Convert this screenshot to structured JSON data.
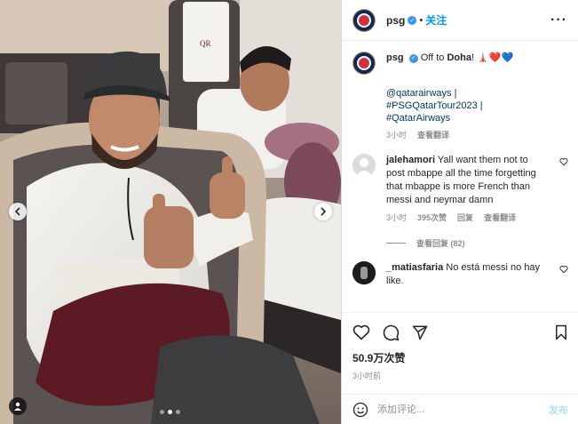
{
  "post": {
    "account": "psg",
    "follow_label": "关注",
    "dot_separator": "•",
    "more_icon": "more-horizontal-icon",
    "caption": {
      "text": "Off to ",
      "emphasis": "Doha",
      "suffix": "! ",
      "emojis": [
        "🗼",
        "❤️",
        "💙"
      ],
      "hashtags": [
        "@qatarairways |",
        "#PSGQatarTour2023 |",
        "#QatarAirways"
      ],
      "time": "3小时",
      "translate": "查看翻译"
    },
    "comments": [
      {
        "user": "jalehamori",
        "text": "Yall want them not to post mbappe all the time forgetting that mbappe is more French than messi and neymar damn",
        "time": "3小时",
        "likes": "395次赞",
        "reply": "回复",
        "translate": "查看翻译",
        "view_replies": "查看回复 (82)"
      },
      {
        "user": "_matiasfaria",
        "text": "No está messi no hay like."
      }
    ],
    "likes_count": "50.9万次赞",
    "posted": "3小时前",
    "comment_placeholder": "添加评论...",
    "post_label": "发布",
    "carousel": {
      "slides": 3,
      "active": 1
    },
    "colors": {
      "accent": "#0095f6",
      "verified": "#3897f0",
      "link": "#00376b",
      "muted": "#8e8e8e"
    }
  }
}
